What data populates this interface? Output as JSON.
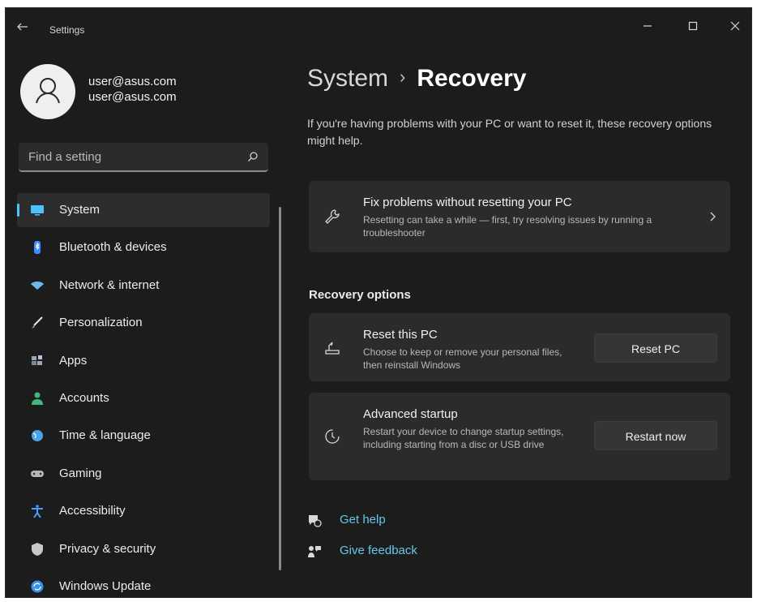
{
  "window": {
    "title": "Settings",
    "controls": {
      "minimize": "—",
      "maximize": "□",
      "close": "✕"
    }
  },
  "profile": {
    "name": "user@asus.com",
    "email": "user@asus.com"
  },
  "search": {
    "placeholder": "Find a setting"
  },
  "nav": {
    "items": [
      {
        "label": "System",
        "icon": "display-icon",
        "color": "#4cc2ff",
        "active": true
      },
      {
        "label": "Bluetooth & devices",
        "icon": "bluetooth-icon",
        "color": "#3a8fff"
      },
      {
        "label": "Network & internet",
        "icon": "wifi-icon",
        "color": "#6fb9e8"
      },
      {
        "label": "Personalization",
        "icon": "brush-icon",
        "color": "#e89a54"
      },
      {
        "label": "Apps",
        "icon": "apps-icon",
        "color": "#9aa6b8"
      },
      {
        "label": "Accounts",
        "icon": "person-icon",
        "color": "#3fb97a"
      },
      {
        "label": "Time & language",
        "icon": "globe-icon",
        "color": "#4aa3e8"
      },
      {
        "label": "Gaming",
        "icon": "gamepad-icon",
        "color": "#b6b6b6"
      },
      {
        "label": "Accessibility",
        "icon": "accessibility-icon",
        "color": "#4a9cff"
      },
      {
        "label": "Privacy & security",
        "icon": "shield-icon",
        "color": "#c8c8c8"
      },
      {
        "label": "Windows Update",
        "icon": "update-icon",
        "color": "#3a8fe8"
      }
    ]
  },
  "main": {
    "breadcrumb_parent": "System",
    "breadcrumb_separator": "›",
    "page_title": "Recovery",
    "description": "If you're having problems with your PC or want to reset it, these recovery options might help.",
    "fix_card": {
      "title": "Fix problems without resetting your PC",
      "subtitle": "Resetting can take a while — first, try resolving issues by running a troubleshooter"
    },
    "section_title": "Recovery options",
    "reset_card": {
      "title": "Reset this PC",
      "subtitle": "Choose to keep or remove your personal files, then reinstall Windows",
      "button": "Reset PC"
    },
    "advanced_card": {
      "title": "Advanced startup",
      "subtitle": "Restart your device to change startup settings, including starting from a disc or USB drive",
      "button": "Restart now"
    },
    "links": {
      "help": "Get help",
      "feedback": "Give feedback"
    }
  },
  "colors": {
    "accent": "#4cc2ff",
    "link": "#64c8e8",
    "background": "#1c1c1c",
    "card": "#2b2b2b"
  }
}
